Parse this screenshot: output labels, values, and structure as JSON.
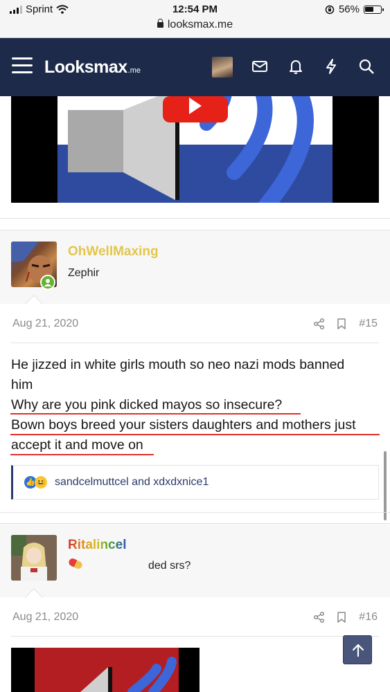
{
  "status_bar": {
    "carrier": "Sprint",
    "time": "12:54 PM",
    "battery": "56%",
    "battery_level": 0.56
  },
  "browser": {
    "url": "looksmax.me"
  },
  "header": {
    "brand": "Looksmax",
    "brand_suffix": ".me",
    "icons": [
      "menu-icon",
      "avatar",
      "mail-icon",
      "bell-icon",
      "lightning-icon",
      "search-icon"
    ]
  },
  "posts": [
    {
      "username": "OhWellMaxing",
      "username_color": "#e3c64a",
      "user_title": "Zephir",
      "date": "Aug 21, 2020",
      "number": "#15",
      "body_lines": [
        "He jizzed in white girls mouth so neo nazi mods banned",
        "him",
        "Why are you pink dicked mayos so insecure?",
        "Bown boys breed your sisters daughters and mothers just",
        "accept it and move on"
      ],
      "reactions": "sandcelmuttcel and xdxdxnice1"
    },
    {
      "username": "Ritalincel",
      "user_title": "ded srs?",
      "date": "Aug 21, 2020",
      "number": "#16"
    }
  ],
  "colors": {
    "navbar": "#1d2a4a",
    "accent": "#2b3a6a",
    "underline": "#e0302a",
    "online": "#63b330"
  }
}
